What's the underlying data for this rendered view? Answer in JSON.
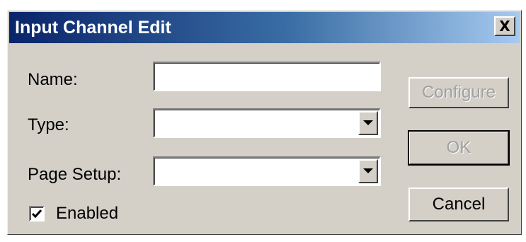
{
  "window": {
    "title": "Input Channel Edit",
    "close_label": "X"
  },
  "form": {
    "name_label": "Name:",
    "name_value": "",
    "type_label": "Type:",
    "type_value": "",
    "page_setup_label": "Page Setup:",
    "page_setup_value": "",
    "enabled_label": "Enabled",
    "enabled_checked": true
  },
  "buttons": {
    "configure_label": "Configure",
    "configure_enabled": false,
    "ok_label": "OK",
    "ok_enabled": false,
    "cancel_label": "Cancel",
    "cancel_enabled": true
  },
  "icons": {
    "dropdown": "chevron-down-icon",
    "check": "checkmark-icon",
    "close": "close-icon"
  },
  "colors": {
    "title_gradient_start": "#0a246a",
    "title_gradient_end": "#a6caf0",
    "dialog_face": "#d4d0c8",
    "disabled_text": "#a0a0a0"
  }
}
